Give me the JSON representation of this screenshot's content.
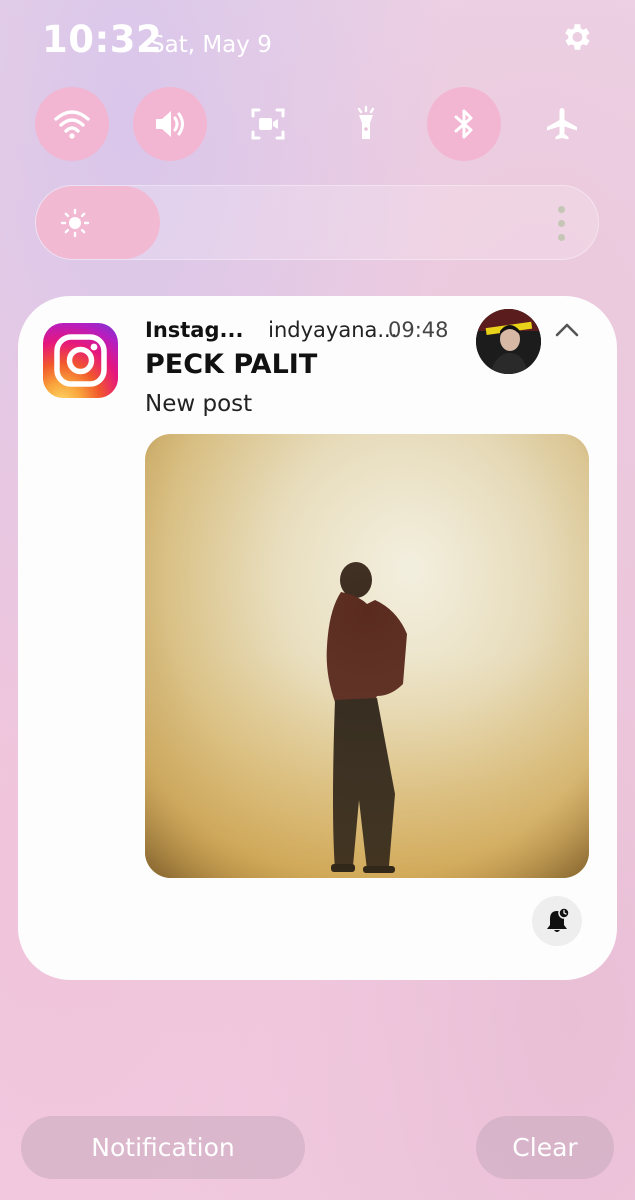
{
  "status_bar": {
    "time": "10:32",
    "date": "Sat, May 9",
    "settings_icon": "gear-icon"
  },
  "quick_tiles": [
    {
      "name": "wifi",
      "icon": "wifi-icon",
      "active": true
    },
    {
      "name": "sound",
      "icon": "volume-icon",
      "active": true
    },
    {
      "name": "screen-recorder",
      "icon": "screen-record-icon",
      "active": false
    },
    {
      "name": "flashlight",
      "icon": "flashlight-icon",
      "active": false
    },
    {
      "name": "bluetooth",
      "icon": "bluetooth-icon",
      "active": true
    },
    {
      "name": "airplane-mode",
      "icon": "airplane-icon",
      "active": false
    }
  ],
  "brightness": {
    "level": 0.22,
    "icon": "sun-icon"
  },
  "notification": {
    "app_name": "Instag...",
    "account": "indyayana...",
    "time": "09:48",
    "title": "PECK PALIT",
    "text": "New post",
    "app_icon": "instagram-icon",
    "expand_icon": "chevron-up-icon",
    "bell_icon": "bell-snooze-icon"
  },
  "footer": {
    "notification_settings_label": "Notification",
    "clear_label": "Clear"
  },
  "colors": {
    "tile_active": "#f2b6d2",
    "card_background": "#fdfdfd"
  }
}
